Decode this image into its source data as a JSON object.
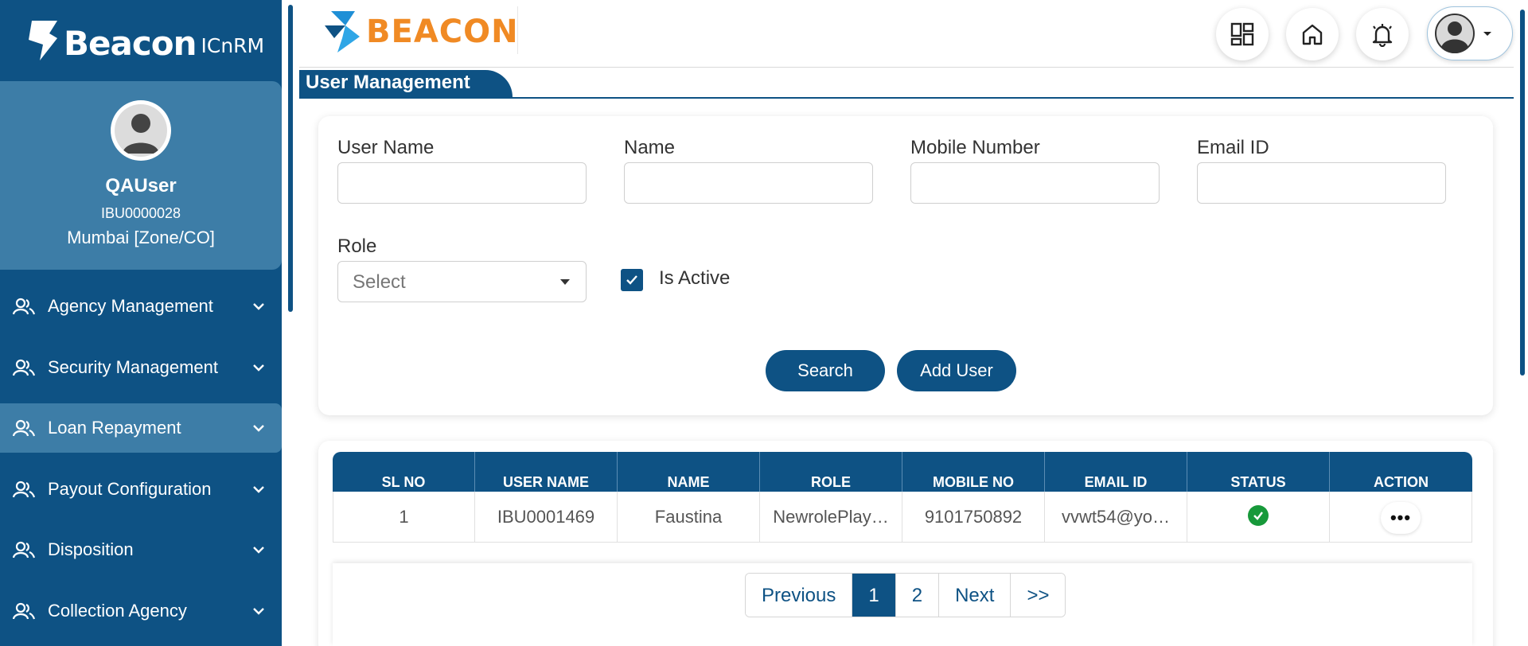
{
  "sidebar": {
    "brand": {
      "name": "Beacon",
      "product": "ICnRM"
    },
    "profile": {
      "username": "QAUser",
      "user_id": "IBU0000028",
      "location": "Mumbai [Zone/CO]"
    },
    "items": [
      {
        "label": "Agency Management"
      },
      {
        "label": "Security Management"
      },
      {
        "label": "Loan Repayment"
      },
      {
        "label": "Payout Configuration"
      },
      {
        "label": "Disposition"
      },
      {
        "label": "Collection Agency"
      }
    ],
    "active_item": "Loan Repayment"
  },
  "header": {
    "logo_text": "BEACON",
    "buttons": [
      "dashboard-icon",
      "home-icon",
      "bell-icon",
      "user-avatar-icon"
    ]
  },
  "page": {
    "title": "User Management"
  },
  "filters": {
    "user_name_label": "User Name",
    "user_name_value": "",
    "name_label": "Name",
    "name_value": "",
    "mobile_label": "Mobile Number",
    "mobile_value": "",
    "email_label": "Email ID",
    "email_value": "",
    "role_label": "Role",
    "role_selected": "Select",
    "is_active_label": "Is Active",
    "is_active_checked": true,
    "search_label": "Search",
    "add_user_label": "Add User"
  },
  "table": {
    "columns": [
      "SL NO",
      "USER NAME",
      "NAME",
      "ROLE",
      "MOBILE NO",
      "EMAIL ID",
      "STATUS",
      "ACTION"
    ],
    "rows": [
      {
        "sl": "1",
        "user_name": "IBU0001469",
        "name": "Faustina",
        "role": "NewrolePlay…",
        "mobile": "9101750892",
        "email": "vvwt54@yo…",
        "status": "active",
        "action": "•••"
      }
    ]
  },
  "pagination": {
    "previous": "Previous",
    "pages": [
      "1",
      "2"
    ],
    "current": "1",
    "next": "Next",
    "last": ">>"
  },
  "colors": {
    "primary": "#0e5284",
    "sidebar_active": "#3d7da7",
    "logo_orange": "#f08a24",
    "status_green": "#17993a"
  }
}
